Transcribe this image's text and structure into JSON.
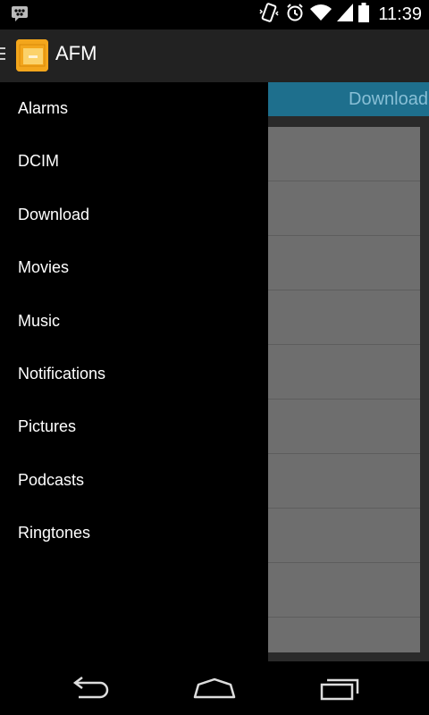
{
  "status_bar": {
    "time": "11:39",
    "icons": [
      "bbm-icon",
      "vibrate-icon",
      "alarm-icon",
      "wifi-icon",
      "signal-icon",
      "battery-icon"
    ]
  },
  "action_bar": {
    "title": "AFM",
    "icon": "folder-icon",
    "icon_color": "#f3a61c"
  },
  "content": {
    "tab_label": "Download",
    "tab_color": "#1e6f8d"
  },
  "drawer": {
    "items": [
      {
        "label": "Alarms"
      },
      {
        "label": "DCIM"
      },
      {
        "label": "Download"
      },
      {
        "label": "Movies"
      },
      {
        "label": "Music"
      },
      {
        "label": "Notifications"
      },
      {
        "label": "Pictures"
      },
      {
        "label": "Podcasts"
      },
      {
        "label": "Ringtones"
      }
    ]
  },
  "nav_bar": {
    "buttons": [
      "back-icon",
      "home-icon",
      "recents-icon"
    ]
  }
}
